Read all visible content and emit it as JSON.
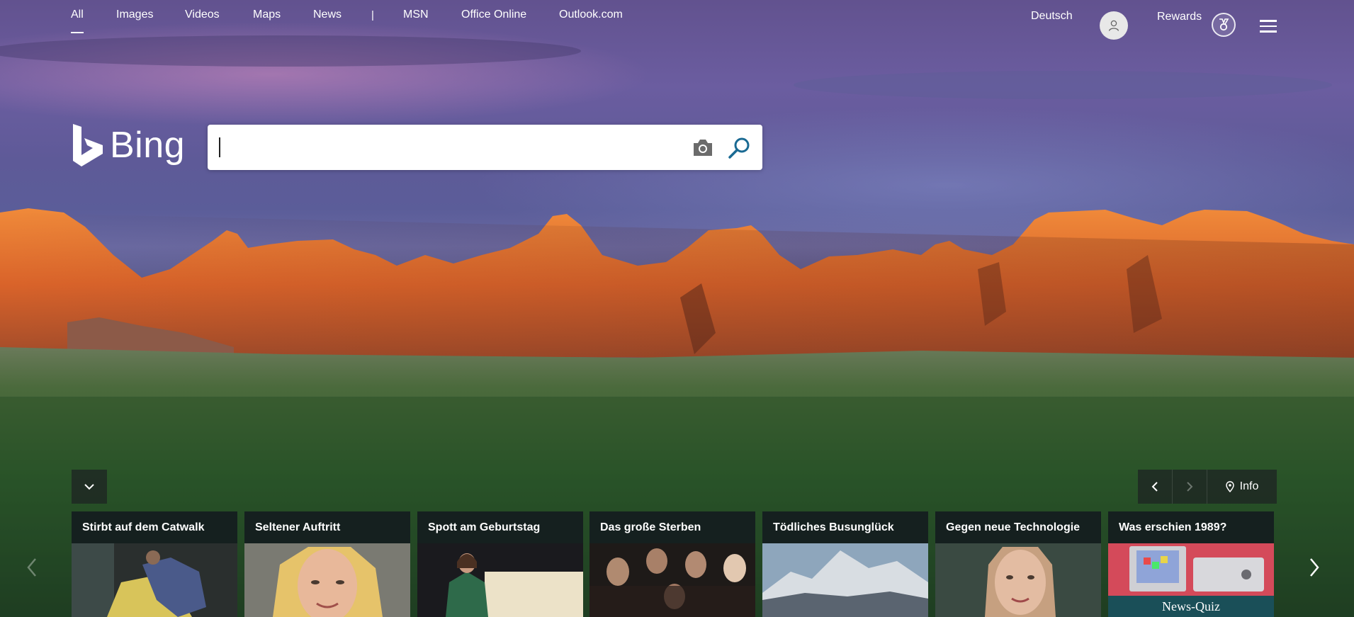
{
  "nav": {
    "items": [
      "All",
      "Images",
      "Videos",
      "Maps",
      "News"
    ],
    "separator": "|",
    "external": [
      "MSN",
      "Office Online",
      "Outlook.com"
    ],
    "active": "All"
  },
  "header": {
    "language": "Deutsch",
    "rewards_label": "Rewards"
  },
  "logo": {
    "text": "Bing"
  },
  "search": {
    "value": "",
    "placeholder": ""
  },
  "controls": {
    "info_label": "Info"
  },
  "cards": [
    {
      "title": "Stirbt auf dem Catwalk"
    },
    {
      "title": "Seltener Auftritt"
    },
    {
      "title": "Spott am Geburtstag"
    },
    {
      "title": "Das große Sterben"
    },
    {
      "title": "Tödliches Busunglück"
    },
    {
      "title": "Gegen neue Technologie"
    },
    {
      "title": "Was erschien 1989?",
      "caption": "News-Quiz"
    }
  ],
  "colors": {
    "sky": "#62528f",
    "cliff": "#e0702a",
    "grass": "#2f5a32",
    "accent": "#1a6a93"
  }
}
